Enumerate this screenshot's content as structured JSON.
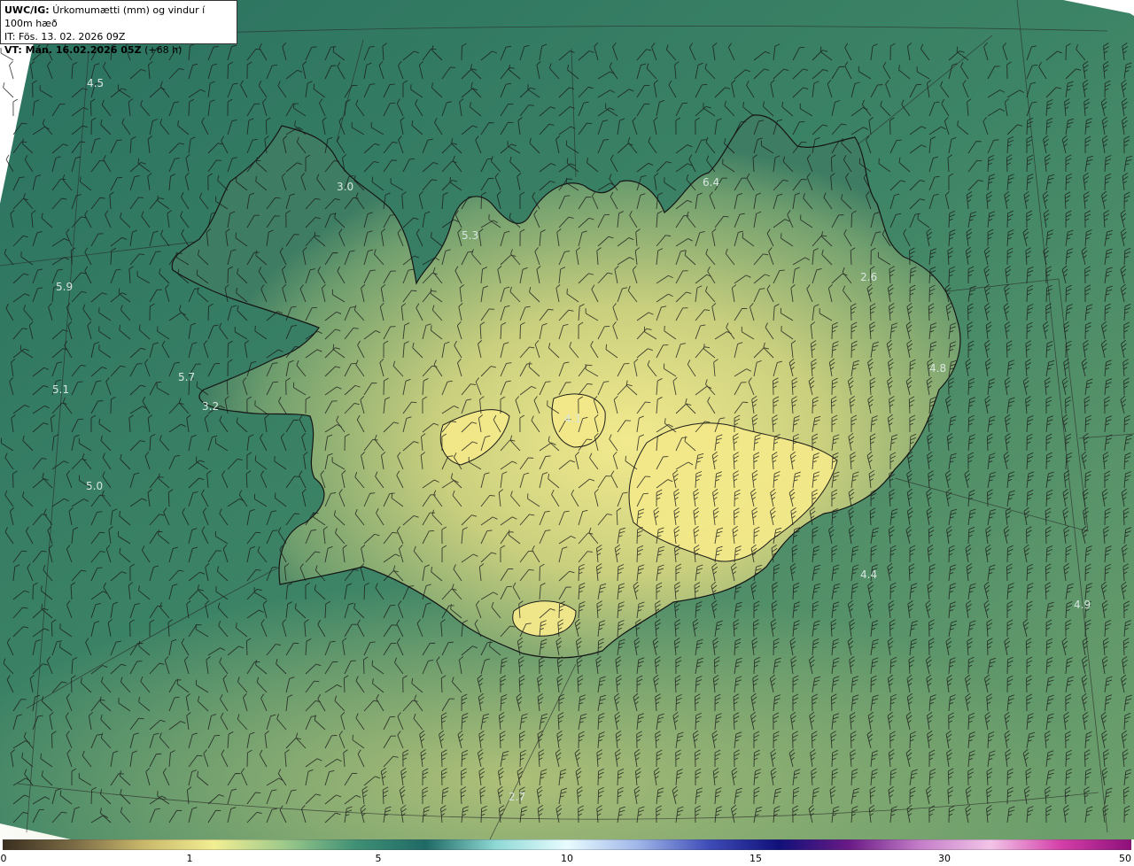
{
  "header": {
    "product": "UWC/IG:",
    "title": "Úrkomumætti (mm) og vindur í 100m hæð",
    "init_time": "IT: Fös. 13. 02. 2026 09Z",
    "valid_prefix": "VT: Mán. 16.02.2026 05Z",
    "valid_lead": "(+68 h)"
  },
  "field_value_labels": [
    {
      "value": "4.5"
    },
    {
      "value": "3.0"
    },
    {
      "value": "5.3"
    },
    {
      "value": "6.4"
    },
    {
      "value": "5.9"
    },
    {
      "value": "2.6"
    },
    {
      "value": "5.7"
    },
    {
      "value": "5.1"
    },
    {
      "value": "3.2"
    },
    {
      "value": "4.8"
    },
    {
      "value": "4.1"
    },
    {
      "value": "5.0"
    },
    {
      "value": "4.4"
    },
    {
      "value": "4.9"
    },
    {
      "value": "2.7"
    }
  ],
  "colorbar": {
    "ticks": [
      "0",
      "1",
      "5",
      "10",
      "15",
      "30",
      "50"
    ],
    "colors": [
      "#3a2f1f",
      "#7a6a45",
      "#c8b86a",
      "#f2ee92",
      "#9cc98a",
      "#3f9075",
      "#1f6a66",
      "#8fd9d6",
      "#e8fcff",
      "#9fb6e8",
      "#3f4db8",
      "#10107a",
      "#6a1a86",
      "#c47dc8",
      "#f2c4e8",
      "#d43fa8",
      "#8e0f7a"
    ]
  },
  "colors": {
    "ocean": "#2e7a62",
    "coast": "#1a1a1a",
    "land_high": "#f0e88a",
    "grid": "#333333"
  }
}
